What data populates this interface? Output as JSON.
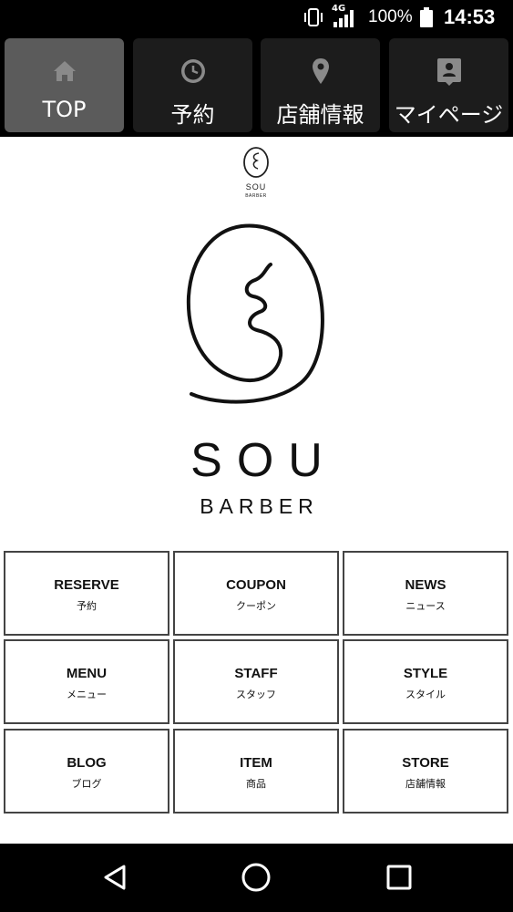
{
  "status_bar": {
    "network": "4G",
    "battery_percent": "100%",
    "time": "14:53"
  },
  "nav": {
    "tabs": [
      {
        "label": "TOP",
        "icon": "home-icon",
        "active": true
      },
      {
        "label": "予約",
        "icon": "clock-icon",
        "active": false
      },
      {
        "label": "店舗情報",
        "icon": "map-pin-icon",
        "active": false
      },
      {
        "label": "マイページ",
        "icon": "member-card-icon",
        "active": false
      }
    ]
  },
  "header": {
    "logo_text": "SOU BARBER"
  },
  "brand": {
    "name": "SOU",
    "sub": "BARBER"
  },
  "menu": {
    "items": [
      {
        "en": "RESERVE",
        "ja": "予約"
      },
      {
        "en": "COUPON",
        "ja": "クーポン"
      },
      {
        "en": "NEWS",
        "ja": "ニュース"
      },
      {
        "en": "MENU",
        "ja": "メニュー"
      },
      {
        "en": "STAFF",
        "ja": "スタッフ"
      },
      {
        "en": "STYLE",
        "ja": "スタイル"
      },
      {
        "en": "BLOG",
        "ja": "ブログ"
      },
      {
        "en": "ITEM",
        "ja": "商品"
      },
      {
        "en": "STORE",
        "ja": "店舗情報"
      }
    ]
  },
  "system_nav": {
    "buttons": [
      "back-icon",
      "home-circle-icon",
      "recents-icon"
    ]
  }
}
